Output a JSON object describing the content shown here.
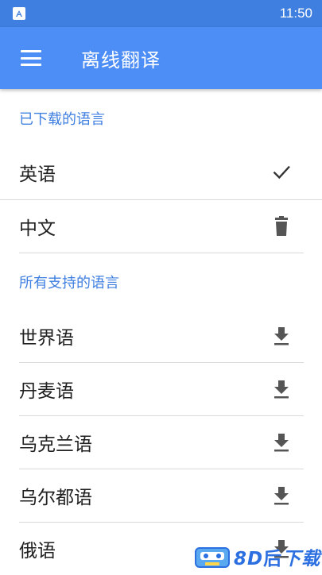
{
  "status_bar": {
    "time": "11:50",
    "app_icon": "android-app-icon"
  },
  "app_bar": {
    "title": "离线翻译",
    "menu_icon": "hamburger-menu-icon"
  },
  "downloaded": {
    "header": "已下载的语言",
    "items": [
      {
        "label": "英语",
        "icon": "check-icon"
      },
      {
        "label": "中文",
        "icon": "trash-icon"
      }
    ]
  },
  "available": {
    "header": "所有支持的语言",
    "items": [
      {
        "label": "世界语",
        "icon": "download-icon"
      },
      {
        "label": "丹麦语",
        "icon": "download-icon"
      },
      {
        "label": "乌克兰语",
        "icon": "download-icon"
      },
      {
        "label": "乌尔都语",
        "icon": "download-icon"
      },
      {
        "label": "俄语",
        "icon": "download-icon"
      }
    ]
  },
  "colors": {
    "app_bar": "#4C8DF6",
    "status_bar": "#3F7FE0",
    "section_header": "#3F7FE0",
    "icon": "#555555",
    "divider": "#DADADA"
  },
  "watermark": {
    "text": "8D",
    "suffix": "下载"
  }
}
